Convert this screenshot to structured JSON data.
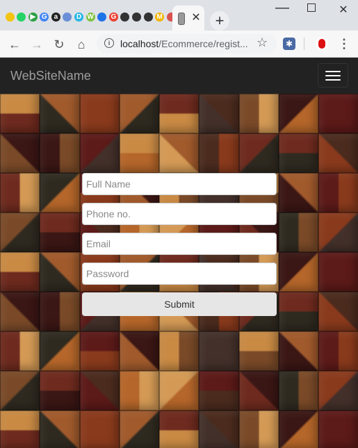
{
  "browser": {
    "tab_favicons": [
      {
        "icon": "yellow-circle-icon",
        "color": "#f2c40f",
        "glyph": ""
      },
      {
        "icon": "whatsapp-icon",
        "color": "#25d366",
        "glyph": ""
      },
      {
        "icon": "play-icon",
        "color": "#2ea043",
        "glyph": "▶"
      },
      {
        "icon": "google-icon",
        "color": "#4285f4",
        "glyph": "G"
      },
      {
        "icon": "amazon-icon",
        "color": "#222222",
        "glyph": "a"
      },
      {
        "icon": "blue-circle-icon",
        "color": "#6a8fd6",
        "glyph": ""
      },
      {
        "icon": "cyan-d-icon",
        "color": "#27b6e6",
        "glyph": "D"
      },
      {
        "icon": "chart-icon",
        "color": "#7fc241",
        "glyph": "W"
      },
      {
        "icon": "blue-shield-icon",
        "color": "#1e73e8",
        "glyph": ""
      },
      {
        "icon": "google-icon",
        "color": "#ea4335",
        "glyph": "G"
      },
      {
        "icon": "head-icon",
        "color": "#333333",
        "glyph": ""
      },
      {
        "icon": "head-icon",
        "color": "#333333",
        "glyph": ""
      },
      {
        "icon": "head-icon",
        "color": "#333333",
        "glyph": ""
      },
      {
        "icon": "yellow-m-icon",
        "color": "#f4b400",
        "glyph": "M"
      },
      {
        "icon": "red-shield-icon",
        "color": "#d9534f",
        "glyph": ""
      },
      {
        "icon": "grey-circle-icon",
        "color": "#888888",
        "glyph": ""
      },
      {
        "icon": "blue-drop-icon",
        "color": "#1565c0",
        "glyph": "o"
      }
    ],
    "active_tab_close": "✕",
    "new_tab_label": "+",
    "window_min": "—",
    "window_close": "✕",
    "url_host": "localhost",
    "url_path": "/Ecommerce/regist...",
    "info_glyph": "i",
    "bookmark_star": "☆",
    "ext_puzzle_glyph": "✱",
    "menu_dots": "⋮",
    "nav_back": "←",
    "nav_forward": "→",
    "nav_reload": "↻",
    "nav_home": "⌂"
  },
  "navbar": {
    "brand": "WebSiteName"
  },
  "background_palette": [
    "#6e2a1e",
    "#3a1614",
    "#8a3a1c",
    "#b5662a",
    "#c98a44",
    "#4b2b1e",
    "#7a4a28",
    "#2f2a20",
    "#5c1a18",
    "#a05a2c",
    "#d49a55",
    "#43302a"
  ],
  "form": {
    "full_name_placeholder": "Full Name",
    "phone_placeholder": "Phone no.",
    "email_placeholder": "Email",
    "password_placeholder": "Password",
    "submit_label": "Submit"
  }
}
